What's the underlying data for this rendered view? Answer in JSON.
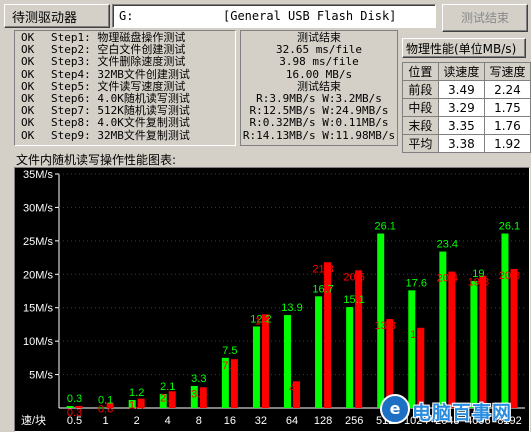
{
  "top": {
    "drive_label": "待测驱动器",
    "drive_letter": "G:",
    "device_name": "[General USB Flash Disk]",
    "test_end_button": "测试结束"
  },
  "steps": [
    {
      "status": "OK",
      "text": "Step1: 物理磁盘操作测试"
    },
    {
      "status": "OK",
      "text": "Step2: 空白文件创建测试"
    },
    {
      "status": "OK",
      "text": "Step3: 文件删除速度测试"
    },
    {
      "status": "OK",
      "text": "Step4: 32MB文件创建测试"
    },
    {
      "status": "OK",
      "text": "Step5: 文件读写速度测试"
    },
    {
      "status": "OK",
      "text": "Step6: 4.0K随机读写测试"
    },
    {
      "status": "OK",
      "text": "Step7: 512K随机读写测试"
    },
    {
      "status": "OK",
      "text": "Step8: 4.0K文件复制测试"
    },
    {
      "status": "OK",
      "text": "Step9: 32MB文件复制测试"
    }
  ],
  "results": [
    "测试结束",
    "32.65 ms/file",
    "3.98 ms/file",
    "16.00 MB/s",
    "测试结束",
    "R:3.9MB/s W:3.2MB/s",
    "R:12.5MB/s W:24.9MB/s",
    "R:0.32MB/s W:0.11MB/s",
    "R:14.13MB/s W:11.98MB/s"
  ],
  "perf": {
    "title": "物理性能(单位MB/s)",
    "headers": [
      "位置",
      "读速度",
      "写速度"
    ],
    "rows": [
      {
        "pos": "前段",
        "read": "3.49",
        "write": "2.24"
      },
      {
        "pos": "中段",
        "read": "3.29",
        "write": "1.75"
      },
      {
        "pos": "末段",
        "read": "3.35",
        "write": "1.76"
      },
      {
        "pos": "平均",
        "read": "3.38",
        "write": "1.92"
      }
    ]
  },
  "chart_caption": "文件内随机读写操作性能图表:",
  "chart_data": {
    "type": "bar",
    "categories": [
      "0.5",
      "1",
      "2",
      "4",
      "8",
      "16",
      "32",
      "64",
      "128",
      "256",
      "512",
      "1024",
      "2048",
      "4096",
      "8192"
    ],
    "series": [
      {
        "values": [
          0.3,
          0.1,
          1.2,
          2.1,
          3.3,
          7.5,
          12.2,
          13.9,
          16.7,
          15.1,
          26.1,
          17.6,
          23.4,
          19.0,
          26.1
        ]
      },
      {
        "values": [
          0.3,
          0.8,
          1.4,
          2.5,
          3.1,
          7.3,
          14.0,
          4.0,
          21.8,
          20.6,
          13.3,
          12.0,
          20.4,
          19.8,
          20.8
        ]
      }
    ],
    "xlabel": "速/块",
    "ylim": [
      0,
      35
    ],
    "yticks": [
      "5M/s",
      "10M/s",
      "15M/s",
      "20M/s",
      "25M/s",
      "30M/s",
      "35M/s"
    ],
    "read_color": "#00ff00",
    "write_color": "#ff0000"
  },
  "watermark": "电脑百事网"
}
